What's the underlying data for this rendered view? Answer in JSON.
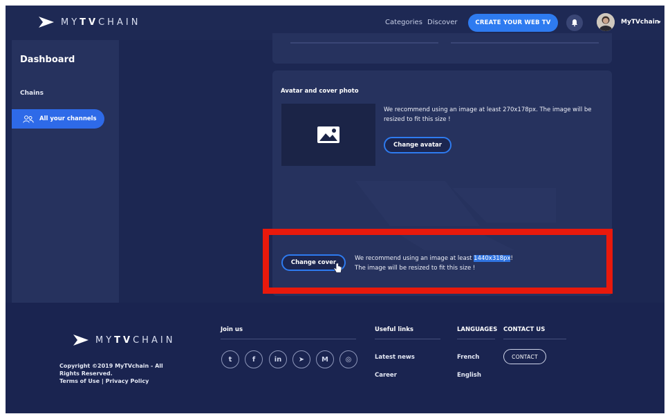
{
  "brand": {
    "logo_prefix": "MY",
    "logo_mid": "TV",
    "logo_suffix": "CHAIN"
  },
  "header": {
    "nav": [
      "Categories",
      "Discover"
    ],
    "cta_label": "CREATE YOUR WEB TV",
    "username": "MyTVchain",
    "user_caret": "▾",
    "icons": [
      "bell-icon",
      "user-avatar"
    ]
  },
  "sidebar": {
    "title": "Dashboard",
    "section": "Chains",
    "active_item": {
      "label": "All your channels",
      "icon": "users-icon"
    }
  },
  "panel": {
    "title": "Avatar and cover photo",
    "avatar_hint": "We recommend using an image at least 270x178px. The image will be resized to fit this size !",
    "change_avatar_label": "Change avatar",
    "change_cover_label": "Change cover",
    "cover_hint_before": "We recommend using an image at least ",
    "cover_hint_highlight": "1440x318px",
    "cover_hint_after": "!",
    "cover_hint_line2": "The image will be resized to fit this size !"
  },
  "footer": {
    "copyright": "Copyright ©2019 MyTVchain - All Rights Reserved.",
    "terms": "Terms of Use",
    "separator": "|",
    "privacy": "Privacy Policy",
    "join_us": "Join us",
    "social": [
      {
        "icon": "twitter-icon",
        "glyph": "t"
      },
      {
        "icon": "facebook-icon",
        "glyph": "f"
      },
      {
        "icon": "linkedin-icon",
        "glyph": "in"
      },
      {
        "icon": "telegram-icon",
        "glyph": "➤"
      },
      {
        "icon": "medium-icon",
        "glyph": "M"
      },
      {
        "icon": "instagram-icon",
        "glyph": "◎"
      }
    ],
    "useful_links": {
      "heading": "Useful links",
      "items": [
        "Latest news",
        "Career"
      ]
    },
    "languages": {
      "heading": "LANGUAGES",
      "items": [
        "French",
        "English"
      ]
    },
    "contact": {
      "heading": "CONTACT US",
      "button": "CONTACT"
    }
  },
  "colors": {
    "accent": "#2e7bf0",
    "highlight_box": "#e8190c",
    "background": "#1c2752"
  }
}
